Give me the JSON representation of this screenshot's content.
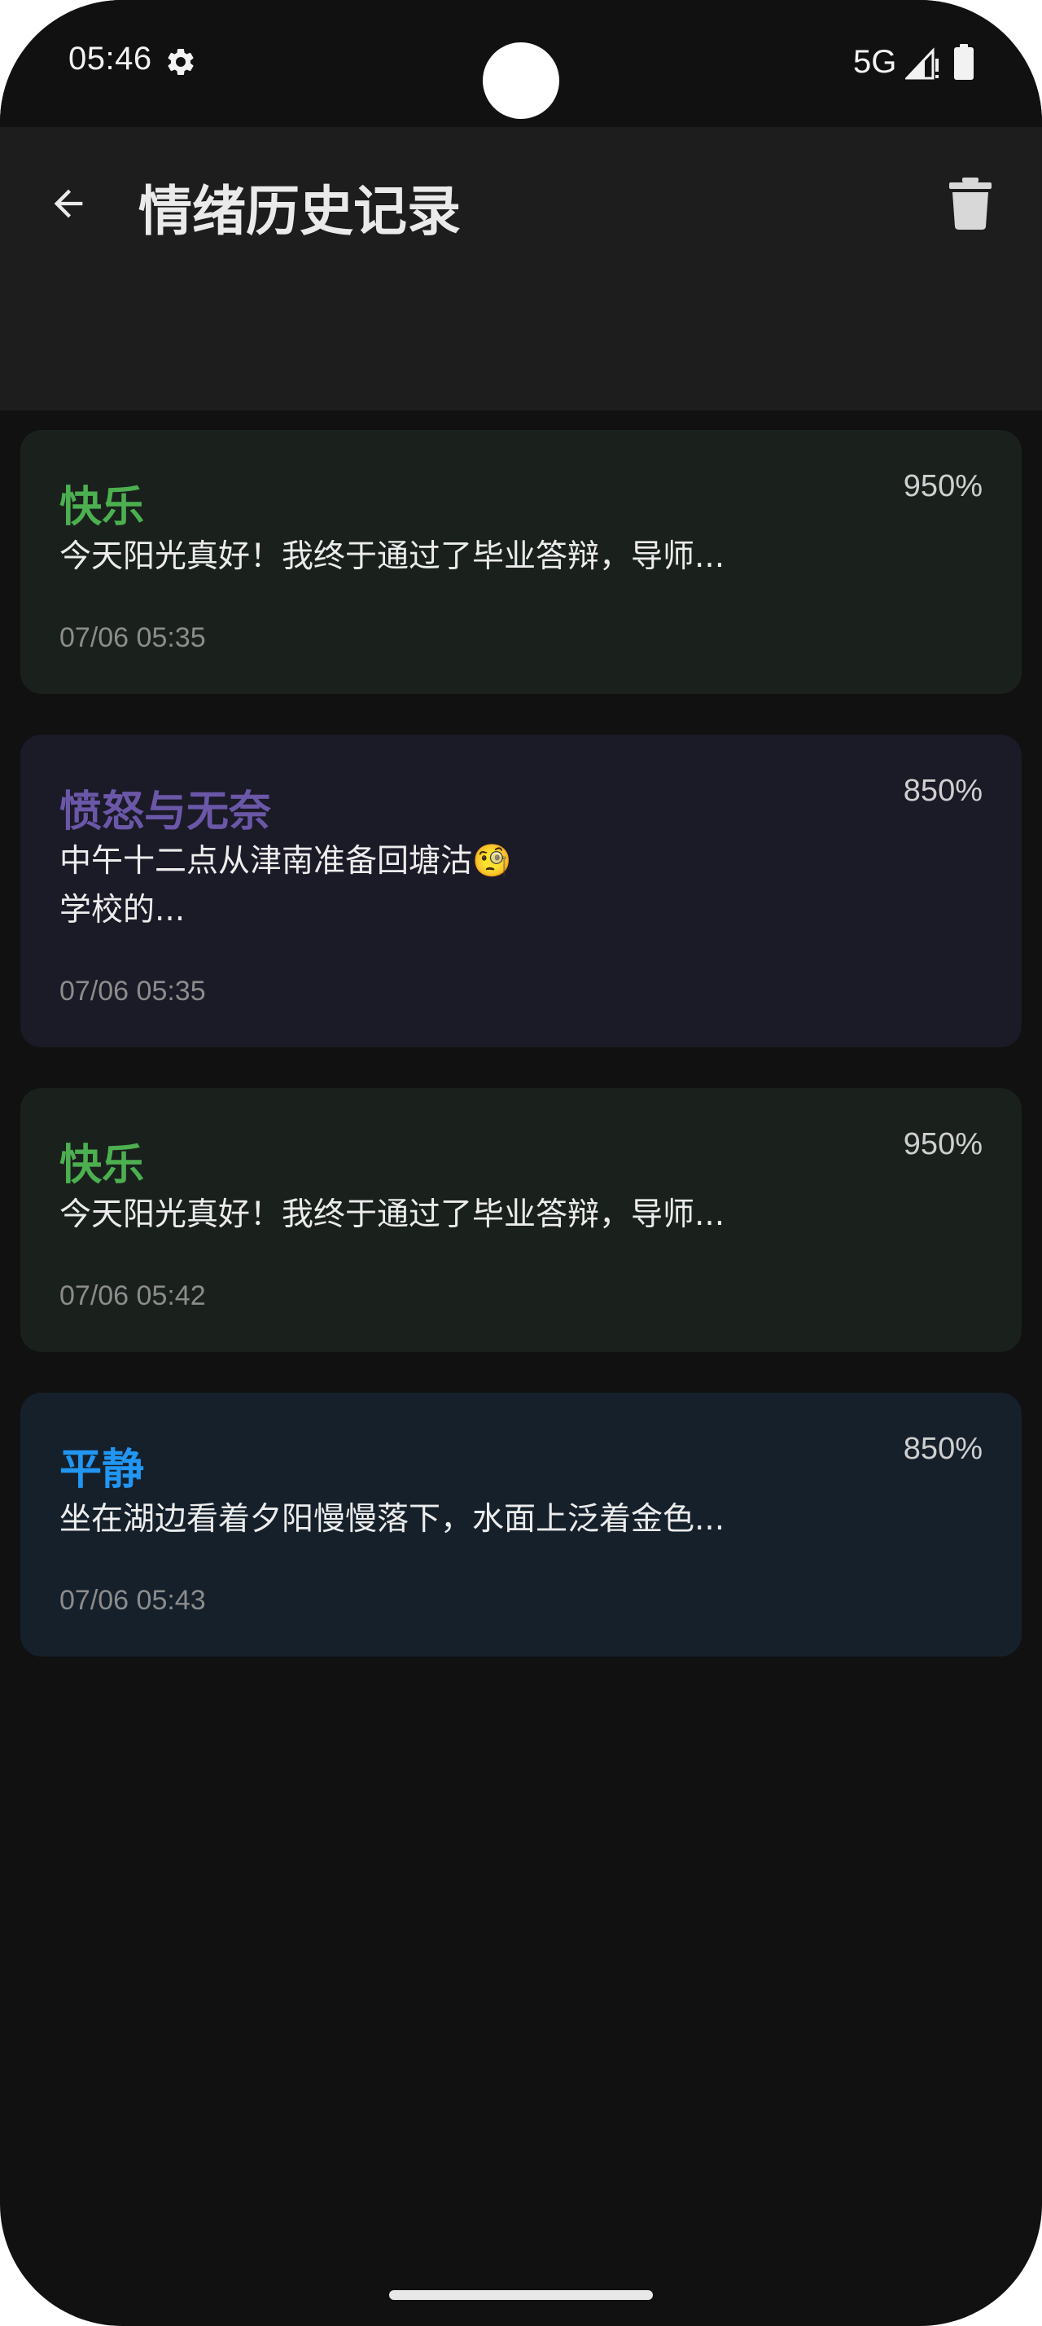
{
  "status_bar": {
    "time": "05:46",
    "network": "5G",
    "icons": [
      "gear-icon",
      "signal-icon",
      "battery-icon"
    ]
  },
  "header": {
    "title": "情绪历史记录",
    "back_icon": "arrow-left-icon",
    "delete_icon": "trash-icon"
  },
  "records": [
    {
      "emotion": "快乐",
      "score": "950%",
      "text": "今天阳光真好！我终于通过了毕业答辩，导师...",
      "time": "07/06 05:35",
      "accent": "#4caf50",
      "bg": "#1a211d"
    },
    {
      "emotion": "愤怒与无奈",
      "score": "850%",
      "text": "中午十二点从津南准备回塘沽🧐\n 学校的...",
      "time": "07/06 05:35",
      "accent": "#6b57a8",
      "bg": "#1b1a27"
    },
    {
      "emotion": "快乐",
      "score": "950%",
      "text": "今天阳光真好！我终于通过了毕业答辩，导师...",
      "time": "07/06 05:42",
      "accent": "#4caf50",
      "bg": "#1a211d"
    },
    {
      "emotion": "平静",
      "score": "850%",
      "text": "坐在湖边看着夕阳慢慢落下，水面上泛着金色...",
      "time": "07/06 05:43",
      "accent": "#2196f3",
      "bg": "#15202b"
    }
  ],
  "colors": {
    "background": "#111111",
    "app_bar": "#1d1d1d"
  }
}
